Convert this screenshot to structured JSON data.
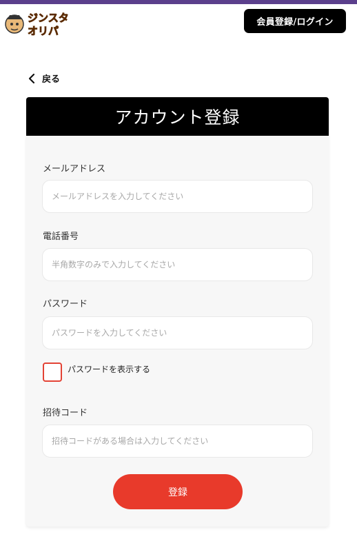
{
  "header": {
    "logo_text_top": "ジンスタ",
    "logo_text_bottom": "オリパ",
    "login_button": "会員登録/ログイン"
  },
  "nav": {
    "back_label": "戻る"
  },
  "form": {
    "title": "アカウント登録",
    "email": {
      "label": "メールアドレス",
      "placeholder": "メールアドレスを入力してください",
      "value": ""
    },
    "phone": {
      "label": "電話番号",
      "placeholder": "半角数字のみで入力してください",
      "value": ""
    },
    "password": {
      "label": "パスワード",
      "placeholder": "パスワードを入力してください",
      "value": ""
    },
    "show_password": {
      "label": "パスワードを表示する",
      "checked": false
    },
    "invite_code": {
      "label": "招待コード",
      "placeholder": "招待コードがある場合は入力してください",
      "value": ""
    },
    "submit_label": "登録"
  },
  "colors": {
    "accent": "#e83a2b",
    "top_strip": "#5b3f8c",
    "header_bg": "#000000"
  }
}
